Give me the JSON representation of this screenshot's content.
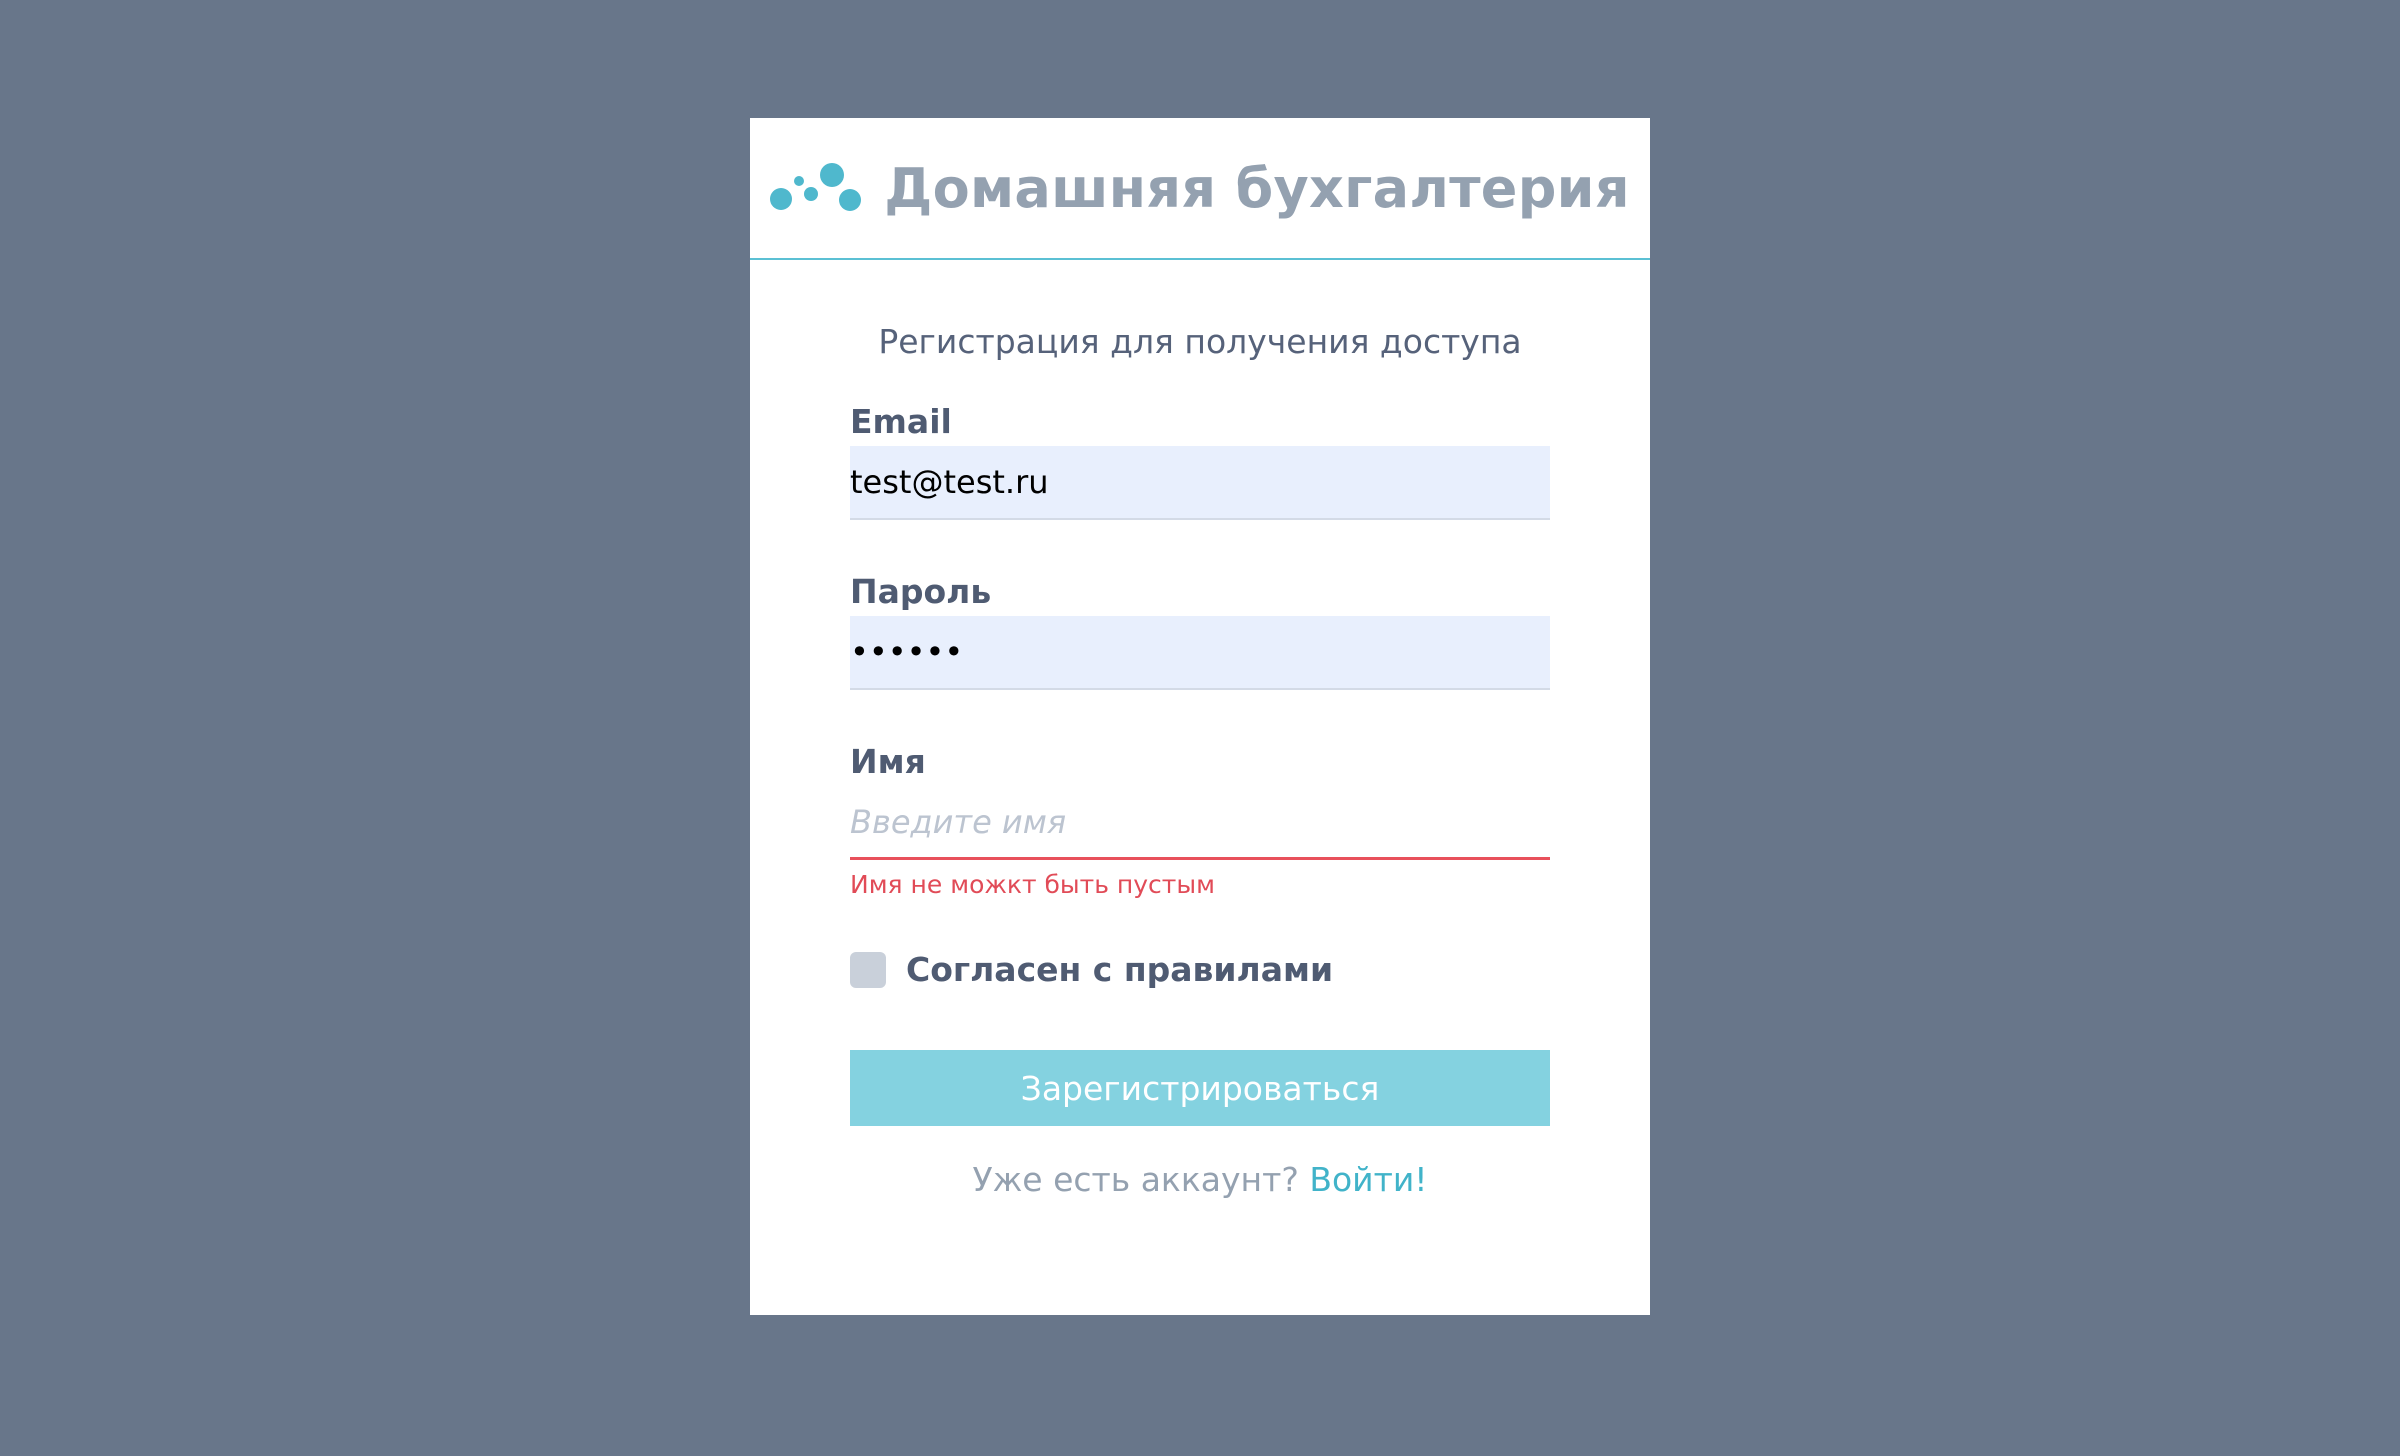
{
  "app": {
    "title": "Домашняя бухгалтерия",
    "logo_icon": "bubbles-logo-icon",
    "accent_color": "#5bc0d4"
  },
  "form": {
    "subtitle": "Регистрация для получения доступа",
    "email": {
      "label": "Email",
      "value": "test@test.ru"
    },
    "password": {
      "label": "Пароль",
      "value": "••••••"
    },
    "name": {
      "label": "Имя",
      "value": "",
      "placeholder": "Введите имя",
      "error": "Имя не можкт быть пустым"
    },
    "agree": {
      "label": "Согласен с правилами",
      "checked": false
    },
    "submit_label": "Зарегистрироваться",
    "login_prompt": "Уже есть аккаунт?",
    "login_link": "Войти!"
  }
}
